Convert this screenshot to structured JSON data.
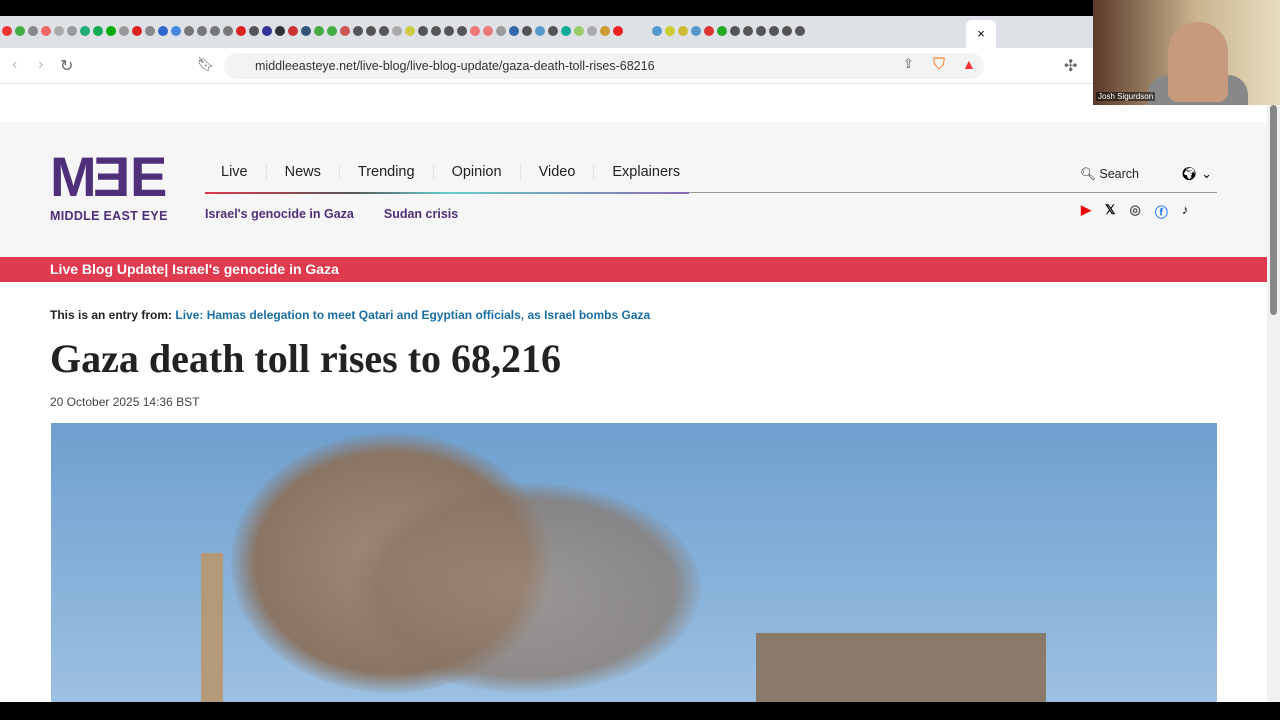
{
  "browser": {
    "url": "middleeasteye.net/live-blog/live-blog-update/gaza-death-toll-rises-68216",
    "tab_colors": [
      "#e33",
      "#4a4",
      "#888",
      "#e66",
      "#aaa",
      "#999",
      "#2a7",
      "#1a5",
      "#0a0",
      "#999",
      "#d22",
      "#888",
      "#36c",
      "#48d",
      "#777",
      "#777",
      "#777",
      "#777",
      "#d22",
      "#555",
      "#339",
      "#333",
      "#c33",
      "#357",
      "#4a4",
      "#4a4",
      "#c55",
      "#555",
      "#555",
      "#555",
      "#aaa",
      "#cc4",
      "#555",
      "#555",
      "#555",
      "#555",
      "#e77",
      "#e77",
      "#999",
      "#36a",
      "#555",
      "#59c",
      "#555",
      "#1a9",
      "#9c6",
      "#aaa",
      "#c93",
      "#e22",
      "#59c",
      "#cc3",
      "#cb3",
      "#59c",
      "#d33",
      "#2a2",
      "#555",
      "#555",
      "#555",
      "#555",
      "#555",
      "#555"
    ],
    "close_tab": "×",
    "webcam_label": "Josh Sigurdson"
  },
  "site": {
    "logo_mark": "MEE",
    "logo_text": "MIDDLE EAST EYE",
    "nav": [
      "Live",
      "News",
      "Trending",
      "Opinion",
      "Video",
      "Explainers"
    ],
    "subnav": [
      "Israel's genocide in Gaza",
      "Sudan crisis"
    ],
    "search_label": "Search",
    "social": [
      "youtube",
      "x",
      "instagram",
      "facebook",
      "tiktok"
    ]
  },
  "banner": "Live Blog Update| Israel's genocide in Gaza",
  "article": {
    "entry_prefix": "This is an entry from:",
    "entry_link": "Live: Hamas delegation to meet Qatari and Egyptian officials, as Israel bombs Gaza",
    "title": "Gaza death toll rises to 68,216",
    "date": "20 October 2025 14:36 BST"
  }
}
